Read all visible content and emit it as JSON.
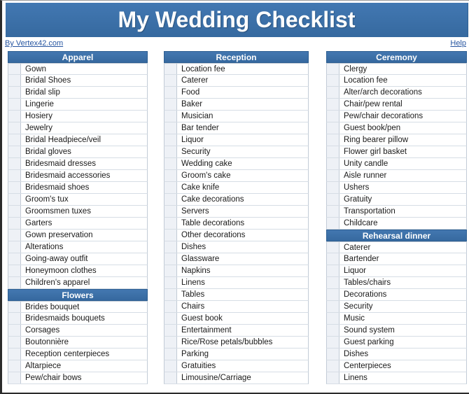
{
  "page": {
    "title": "My Wedding Checklist",
    "byline": "By Vertex42.com",
    "help": "Help"
  },
  "colors": {
    "header_blue": "#3d72ad",
    "link_blue": "#2554a0",
    "checkbox_fill": "#eef1f6"
  },
  "columns": [
    {
      "sections": [
        {
          "title": "Apparel",
          "items": [
            "Gown",
            "Bridal Shoes",
            "Bridal slip",
            "Lingerie",
            "Hosiery",
            "Jewelry",
            "Bridal Headpiece/veil",
            "Bridal gloves",
            "Bridesmaid dresses",
            "Bridesmaid accessories",
            "Bridesmaid shoes",
            "Groom's tux",
            "Groomsmen tuxes",
            "Garters",
            "Gown preservation",
            "Alterations",
            "Going-away outfit",
            "Honeymoon clothes",
            "Children's apparel"
          ]
        },
        {
          "title": "Flowers",
          "items": [
            "Brides bouquet",
            "Bridesmaids bouquets",
            "Corsages",
            "Boutonnière",
            "Reception centerpieces",
            "Altarpiece",
            "Pew/chair bows"
          ]
        }
      ]
    },
    {
      "sections": [
        {
          "title": "Reception",
          "items": [
            "Location fee",
            "Caterer",
            "Food",
            "Baker",
            "Musician",
            "Bar tender",
            "Liquor",
            "Security",
            "Wedding cake",
            "Groom's cake",
            "Cake knife",
            "Cake decorations",
            "Servers",
            "Table decorations",
            "Other decorations",
            "Dishes",
            "Glassware",
            "Napkins",
            "Linens",
            "Tables",
            "Chairs",
            "Guest book",
            "Entertainment",
            "Rice/Rose petals/bubbles",
            "Parking",
            "Gratuities",
            "Limousine/Carriage"
          ]
        }
      ]
    },
    {
      "sections": [
        {
          "title": "Ceremony",
          "items": [
            "Clergy",
            "Location fee",
            "Alter/arch decorations",
            "Chair/pew rental",
            "Pew/chair decorations",
            "Guest book/pen",
            "Ring bearer pillow",
            "Flower girl basket",
            "Unity candle",
            "Aisle runner",
            "Ushers",
            "Gratuity",
            "Transportation",
            "Childcare"
          ]
        },
        {
          "title": "Rehearsal dinner",
          "items": [
            "Caterer",
            "Bartender",
            "Liquor",
            "Tables/chairs",
            "Decorations",
            "Security",
            "Music",
            "Sound system",
            "Guest parking",
            "Dishes",
            "Centerpieces",
            "Linens"
          ]
        }
      ]
    }
  ]
}
